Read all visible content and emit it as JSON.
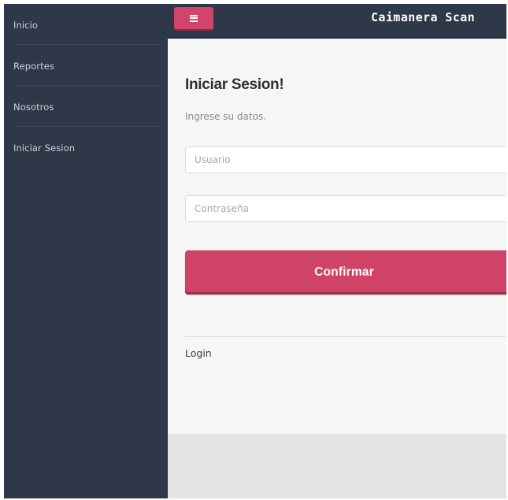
{
  "sidebar": {
    "items": [
      {
        "label": "Inicio"
      },
      {
        "label": "Reportes"
      },
      {
        "label": "Nosotros"
      },
      {
        "label": "Iniciar Sesion"
      }
    ]
  },
  "header": {
    "menu_icon": "hamburger-menu-icon",
    "brand": "Caimanera Scan",
    "accent_color": "#d2456a",
    "bar_color": "#2f3848"
  },
  "form": {
    "title": "Iniciar Sesion!",
    "subtitle": "Ingrese su datos.",
    "username_placeholder": "Usuario",
    "username_value": "",
    "password_placeholder": "Contraseña",
    "password_value": "",
    "submit_label": "Confirmar"
  },
  "footer": {
    "label": "Login"
  }
}
